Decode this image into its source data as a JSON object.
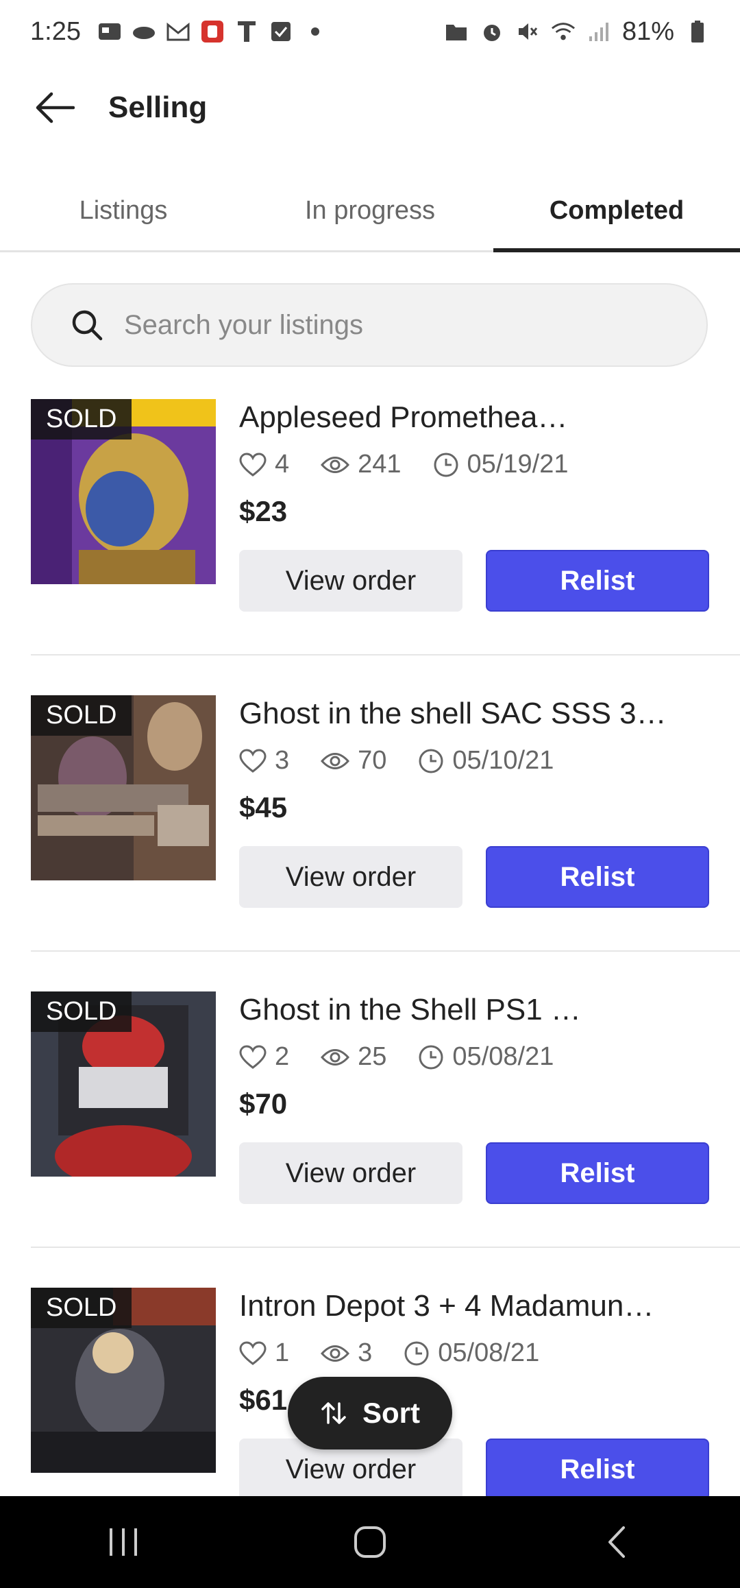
{
  "status_bar": {
    "time": "1:25",
    "battery": "81%"
  },
  "header": {
    "title": "Selling"
  },
  "tabs": [
    {
      "label": "Listings",
      "active": false
    },
    {
      "label": "In progress",
      "active": false
    },
    {
      "label": "Completed",
      "active": true
    }
  ],
  "search": {
    "placeholder": "Search your listings"
  },
  "listings": [
    {
      "badge": "SOLD",
      "title": "Appleseed Promethea…",
      "likes": "4",
      "views": "241",
      "date": "05/19/21",
      "price": "$23",
      "view_label": "View order",
      "relist_label": "Relist"
    },
    {
      "badge": "SOLD",
      "title": "Ghost in the shell SAC SSS 3…",
      "likes": "3",
      "views": "70",
      "date": "05/10/21",
      "price": "$45",
      "view_label": "View order",
      "relist_label": "Relist"
    },
    {
      "badge": "SOLD",
      "title": "Ghost in the Shell PS1 …",
      "likes": "2",
      "views": "25",
      "date": "05/08/21",
      "price": "$70",
      "view_label": "View order",
      "relist_label": "Relist"
    },
    {
      "badge": "SOLD",
      "title": "Intron Depot 3 + 4 Madamun…",
      "likes": "1",
      "views": "3",
      "date": "05/08/21",
      "price": "$61",
      "view_label": "View order",
      "relist_label": "Relist"
    }
  ],
  "sort": {
    "label": "Sort"
  },
  "colors": {
    "accent": "#4b4fea",
    "text": "#222222",
    "muted": "#666666"
  }
}
